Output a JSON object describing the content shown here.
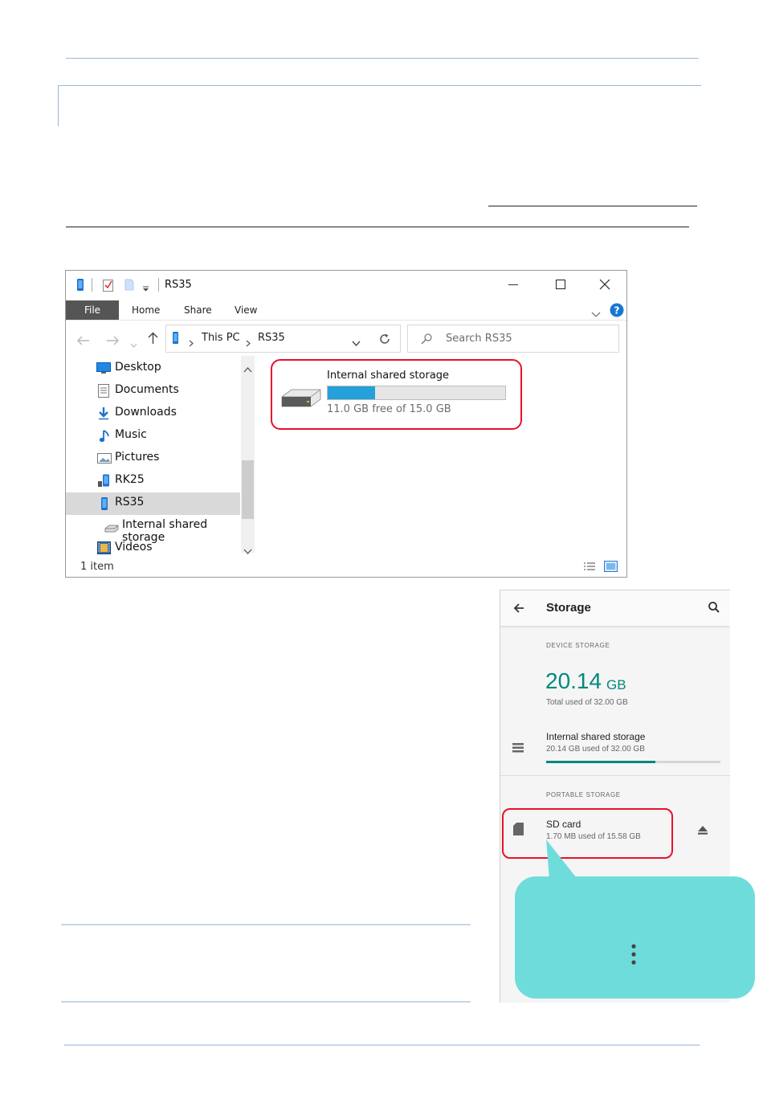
{
  "explorer": {
    "window_title": "RS35",
    "ribbon_tabs": [
      "File",
      "Home",
      "Share",
      "View"
    ],
    "address_path": [
      "This PC",
      "RS35"
    ],
    "search_placeholder": "Search RS35",
    "nav_items": [
      {
        "label": "Desktop",
        "icon": "desktop-icon"
      },
      {
        "label": "Documents",
        "icon": "documents-icon"
      },
      {
        "label": "Downloads",
        "icon": "downloads-icon"
      },
      {
        "label": "Music",
        "icon": "music-icon"
      },
      {
        "label": "Pictures",
        "icon": "pictures-icon"
      },
      {
        "label": "RK25",
        "icon": "device-icon"
      },
      {
        "label": "RS35",
        "icon": "phone-icon",
        "selected": true
      },
      {
        "label": "Internal shared storage",
        "icon": "drive-icon"
      },
      {
        "label": "Videos",
        "icon": "videos-icon"
      }
    ],
    "drive": {
      "name": "Internal shared storage",
      "free_text": "11.0 GB free of 15.0 GB",
      "used_fraction": 0.267
    },
    "status_text": "1 item",
    "colors": {
      "accent": "#26a0da",
      "file_tab": "#555555",
      "highlight": "#e8112d"
    }
  },
  "android": {
    "title": "Storage",
    "device_storage_header": "DEVICE STORAGE",
    "used_value": "20.14",
    "used_unit": "GB",
    "total_text": "Total used of 32.00 GB",
    "internal_title": "Internal shared storage",
    "internal_sub": "20.14 GB used of 32.00 GB",
    "internal_used_fraction": 0.629,
    "portable_header": "PORTABLE STORAGE",
    "sd_title": "SD card",
    "sd_sub": "1.70 MB used of 15.58 GB",
    "colors": {
      "accent": "#00897b",
      "callout": "#6fdcdc"
    }
  }
}
